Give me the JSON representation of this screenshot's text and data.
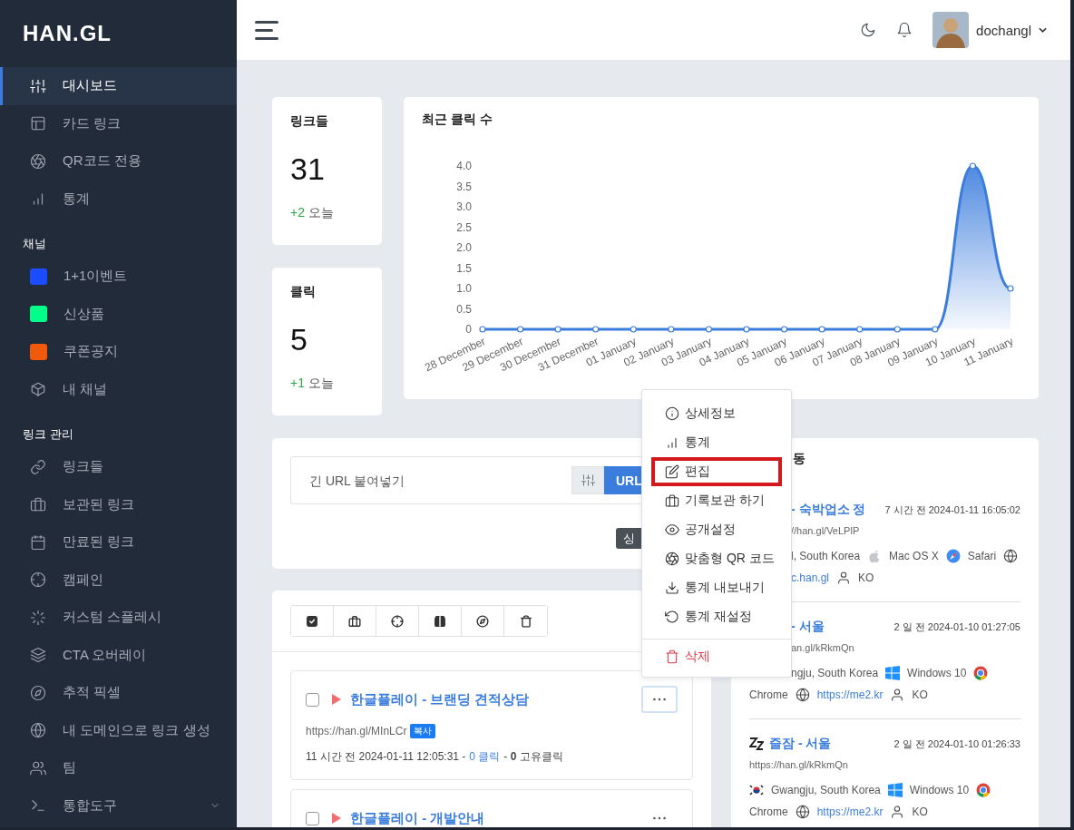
{
  "sidebar": {
    "logo": "HAN.GL",
    "groups": [
      {
        "items": [
          {
            "label": "대시보드",
            "kind": "nav",
            "selected": true
          },
          {
            "label": "카드 링크",
            "kind": "nav",
            "selected": false
          },
          {
            "label": "QR코드 전용",
            "kind": "nav",
            "selected": false
          },
          {
            "label": "통계",
            "kind": "nav",
            "selected": false
          }
        ]
      },
      {
        "title": "채널",
        "items": [
          {
            "label": "1+1이벤트",
            "kind": "channel",
            "color": "#1a4dff",
            "selected": false
          },
          {
            "label": "신상품",
            "kind": "channel",
            "color": "#00ff88",
            "selected": false
          },
          {
            "label": "쿠폰공지",
            "kind": "channel",
            "color": "#f05a0a",
            "selected": false
          },
          {
            "label": "내 채널",
            "kind": "nav",
            "selected": false
          }
        ]
      },
      {
        "title": "링크 관리",
        "items": [
          {
            "label": "링크들",
            "kind": "nav",
            "selected": false
          },
          {
            "label": "보관된 링크",
            "kind": "nav",
            "selected": false
          },
          {
            "label": "만료된 링크",
            "kind": "nav",
            "selected": false
          },
          {
            "label": "캠페인",
            "kind": "nav",
            "selected": false
          },
          {
            "label": "커스텀 스플레시",
            "kind": "nav",
            "selected": false
          },
          {
            "label": "CTA 오버레이",
            "kind": "nav",
            "selected": false
          },
          {
            "label": "추적 픽셀",
            "kind": "nav",
            "selected": false
          },
          {
            "label": "내 도메인으로 링크 생성",
            "kind": "nav",
            "selected": false
          },
          {
            "label": "팀",
            "kind": "nav",
            "selected": false
          },
          {
            "label": "통합도구",
            "kind": "submenu",
            "selected": false
          }
        ]
      }
    ]
  },
  "topbar": {
    "user": "dochangl"
  },
  "stats": [
    {
      "label": "링크들",
      "value": "31",
      "delta": "+2",
      "delta_label": "오늘"
    },
    {
      "label": "클릭",
      "value": "5",
      "delta": "+1",
      "delta_label": "오늘"
    }
  ],
  "clicks_chart": {
    "title": "최근 클릭 수",
    "chart_data": {
      "type": "area",
      "categories": [
        "28 December",
        "29 December",
        "30 December",
        "31 December",
        "01 January",
        "02 January",
        "03 January",
        "04 January",
        "05 January",
        "06 January",
        "07 January",
        "08 January",
        "09 January",
        "10 January",
        "11 January"
      ],
      "values": [
        0,
        0,
        0,
        0,
        0,
        0,
        0,
        0,
        0,
        0,
        0,
        0,
        0,
        4,
        1
      ],
      "ylim": [
        0,
        4
      ],
      "yticks": [
        0,
        {
          "value": 0.5,
          "label": "0.5"
        },
        {
          "value": 1,
          "label": "1.0"
        },
        {
          "value": 1.5,
          "label": "1.5"
        },
        {
          "value": 2,
          "label": "2.0"
        },
        {
          "value": 2.5,
          "label": "2.5"
        },
        {
          "value": 3,
          "label": "3.0"
        },
        {
          "value": 3.5,
          "label": "3.5"
        },
        {
          "value": 4,
          "label": "4.0"
        }
      ]
    }
  },
  "url_form": {
    "placeholder": "긴 URL 붙여넣기",
    "submit": "URL",
    "extra_button": "싱"
  },
  "links": [
    {
      "title": "한글플레이 - 브랜딩 견적상담",
      "checked": false,
      "menu_open": true,
      "url": "https://han.gl/MInLCr",
      "copy": "복사",
      "time": "11 시간 전 2024-01-11 12:05:31 -",
      "clicks": "0 클릭",
      "unique": "- **0** 고유클릭"
    },
    {
      "title": "한글플레이 - 개발안내",
      "checked": false,
      "menu_open": false
    }
  ],
  "menu": [
    {
      "label": "상세정보",
      "kind": "item",
      "highlighted": false
    },
    {
      "label": "통계",
      "kind": "item",
      "highlighted": false
    },
    {
      "label": "편집",
      "kind": "item",
      "highlighted": true
    },
    {
      "label": "기록보관 하기",
      "kind": "item",
      "highlighted": false
    },
    {
      "label": "공개설정",
      "kind": "item",
      "highlighted": false
    },
    {
      "label": "맞춤형 QR 코드",
      "kind": "item",
      "highlighted": false
    },
    {
      "label": "통계 내보내기",
      "kind": "item",
      "highlighted": false
    },
    {
      "label": "통계 재설정",
      "kind": "item",
      "highlighted": false
    },
    {
      "label": "삭제",
      "kind": "danger",
      "highlighted": false
    }
  ],
  "activity": {
    "title": "동",
    "items": [
      {
        "title": "- 숙박업소 정",
        "time": "7 시간 전 2024-01-11 16:05:02",
        "url": "//han.gl/VeLPlP",
        "location": "l, South Korea",
        "os": "Mac OS X",
        "browser": "Safari",
        "referrer": "c.han.gl",
        "lang": "KO"
      },
      {
        "title": "- 서울",
        "time": "2 일 전 2024-01-10 01:27:05",
        "url": "an.gl/kRkmQn",
        "location": "ngju, South Korea",
        "os": "Windows 10",
        "browser": "Chrome",
        "referrer": "https://me2.kr",
        "lang": "KO"
      },
      {
        "title": "즐잠 - 서울",
        "time": "2 일 전 2024-01-10 01:26:33",
        "url": "https://han.gl/kRkmQn",
        "location": "Gwangju, South Korea",
        "os": "Windows 10",
        "browser": "Chrome",
        "referrer": "https://me2.kr",
        "lang": "KO"
      }
    ]
  }
}
